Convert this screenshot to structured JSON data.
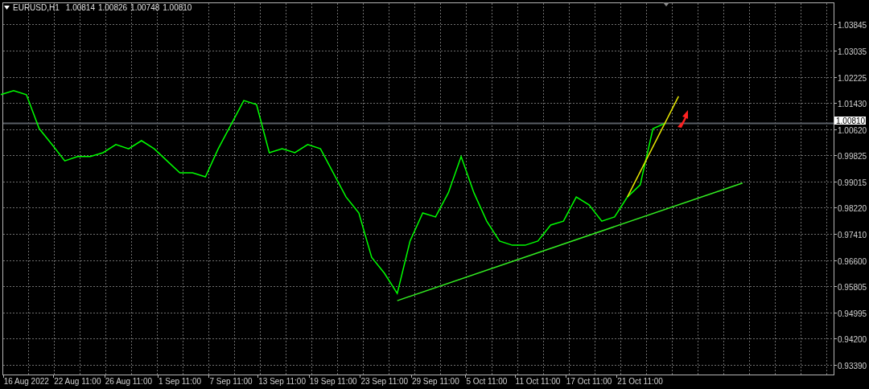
{
  "chart_header": {
    "quotes": [
      "1.00814",
      "1.00826",
      "1.00748",
      "1.00810"
    ]
  },
  "current_price_label": "1.00810",
  "chart_data": {
    "type": "line",
    "grid": true,
    "categories": [
      null,
      null,
      "16 Aug 2022",
      null,
      null,
      null,
      "22 Aug 11:00",
      null,
      null,
      null,
      "26 Aug 11:00",
      null,
      null,
      null,
      "1 Sep 11:00",
      null,
      null,
      null,
      "7 Sep 11:00",
      null,
      null,
      null,
      "13 Sep 11:00",
      null,
      null,
      null,
      "19 Sep 11:00",
      null,
      null,
      null,
      "23 Sep 11:00",
      null,
      null,
      null,
      "29 Sep 11:00",
      null,
      null,
      null,
      "5 Oct 11:00",
      null,
      null,
      null,
      "11 Oct 11:00",
      null,
      null,
      null,
      "17 Oct 11:00",
      null,
      null,
      null,
      "21 Oct 11:00",
      null,
      null,
      null,
      null,
      null,
      null,
      null,
      null,
      null,
      null,
      null,
      null,
      null,
      null
    ],
    "ylim": [
      0.93093,
      1.04511
    ],
    "yticks": [
      {
        "value": 1.03845,
        "label": "1.03845"
      },
      {
        "value": 1.03035,
        "label": "1.03035"
      },
      {
        "value": 1.02225,
        "label": "1.02225"
      },
      {
        "value": 1.0143,
        "label": "1.01430"
      },
      {
        "value": 1.0062,
        "label": "1.00620"
      },
      {
        "value": 0.99825,
        "label": "0.99825"
      },
      {
        "value": 0.99015,
        "label": "0.99015"
      },
      {
        "value": 0.9822,
        "label": "0.98220"
      },
      {
        "value": 0.9741,
        "label": "0.97410"
      },
      {
        "value": 0.966,
        "label": "0.96600"
      },
      {
        "value": 0.95805,
        "label": "0.95805"
      },
      {
        "value": 0.94995,
        "label": "0.94995"
      },
      {
        "value": 0.942,
        "label": "0.94200"
      },
      {
        "value": 0.9339,
        "label": "0.93390"
      }
    ],
    "series": [
      {
        "name": "EURUSD,H1",
        "color": "#00ff00",
        "values": [
          1.0168,
          1.018,
          1.0168,
          1.0064,
          1.0015,
          0.9965,
          0.9978,
          0.9978,
          0.999,
          1.0015,
          1.0002,
          1.0027,
          1.0002,
          0.9965,
          0.9928,
          0.9928,
          0.9916,
          1.0002,
          1.0076,
          1.015,
          1.0138,
          0.999,
          1.0002,
          0.999,
          1.0015,
          1.0002,
          0.9928,
          0.9854,
          0.9805,
          0.9669,
          0.962,
          0.9558,
          0.9719,
          0.9805,
          0.9793,
          0.9867,
          0.9978,
          0.9867,
          0.978,
          0.9719,
          0.9706,
          0.9706,
          0.9719,
          0.9768,
          0.978,
          0.9854,
          0.983,
          0.978,
          0.9793,
          0.9854,
          0.9891,
          1.0064,
          1.0081,
          null,
          null,
          null,
          null,
          null,
          null,
          null,
          null,
          null,
          null,
          null,
          null
        ]
      },
      {
        "color": "#33ee22",
        "values": [
          null,
          null,
          null,
          null,
          null,
          null,
          null,
          null,
          null,
          null,
          null,
          null,
          null,
          null,
          null,
          null,
          null,
          null,
          null,
          null,
          null,
          null,
          null,
          null,
          null,
          null,
          null,
          null,
          null,
          null,
          null,
          0.9536,
          null,
          null,
          null,
          null,
          null,
          null,
          null,
          null,
          null,
          null,
          null,
          null,
          null,
          null,
          null,
          null,
          null,
          null,
          null,
          null,
          null,
          null,
          null,
          null,
          null,
          null,
          0.9897,
          null,
          null,
          null,
          null,
          null,
          null
        ]
      },
      {
        "color": "#e8e800",
        "values": [
          null,
          null,
          null,
          null,
          null,
          null,
          null,
          null,
          null,
          null,
          null,
          null,
          null,
          null,
          null,
          null,
          null,
          null,
          null,
          null,
          null,
          null,
          null,
          null,
          null,
          null,
          null,
          null,
          null,
          null,
          null,
          null,
          null,
          null,
          null,
          null,
          null,
          null,
          null,
          null,
          null,
          null,
          null,
          null,
          null,
          null,
          null,
          null,
          null,
          0.9854,
          null,
          null,
          null,
          1.0163,
          null,
          null,
          null,
          null,
          null,
          null,
          null,
          null,
          null,
          null,
          null
        ]
      }
    ],
    "ref_lines": [
      {
        "axis": "y",
        "value": 1.0081,
        "color": "#5a5f66"
      }
    ]
  }
}
